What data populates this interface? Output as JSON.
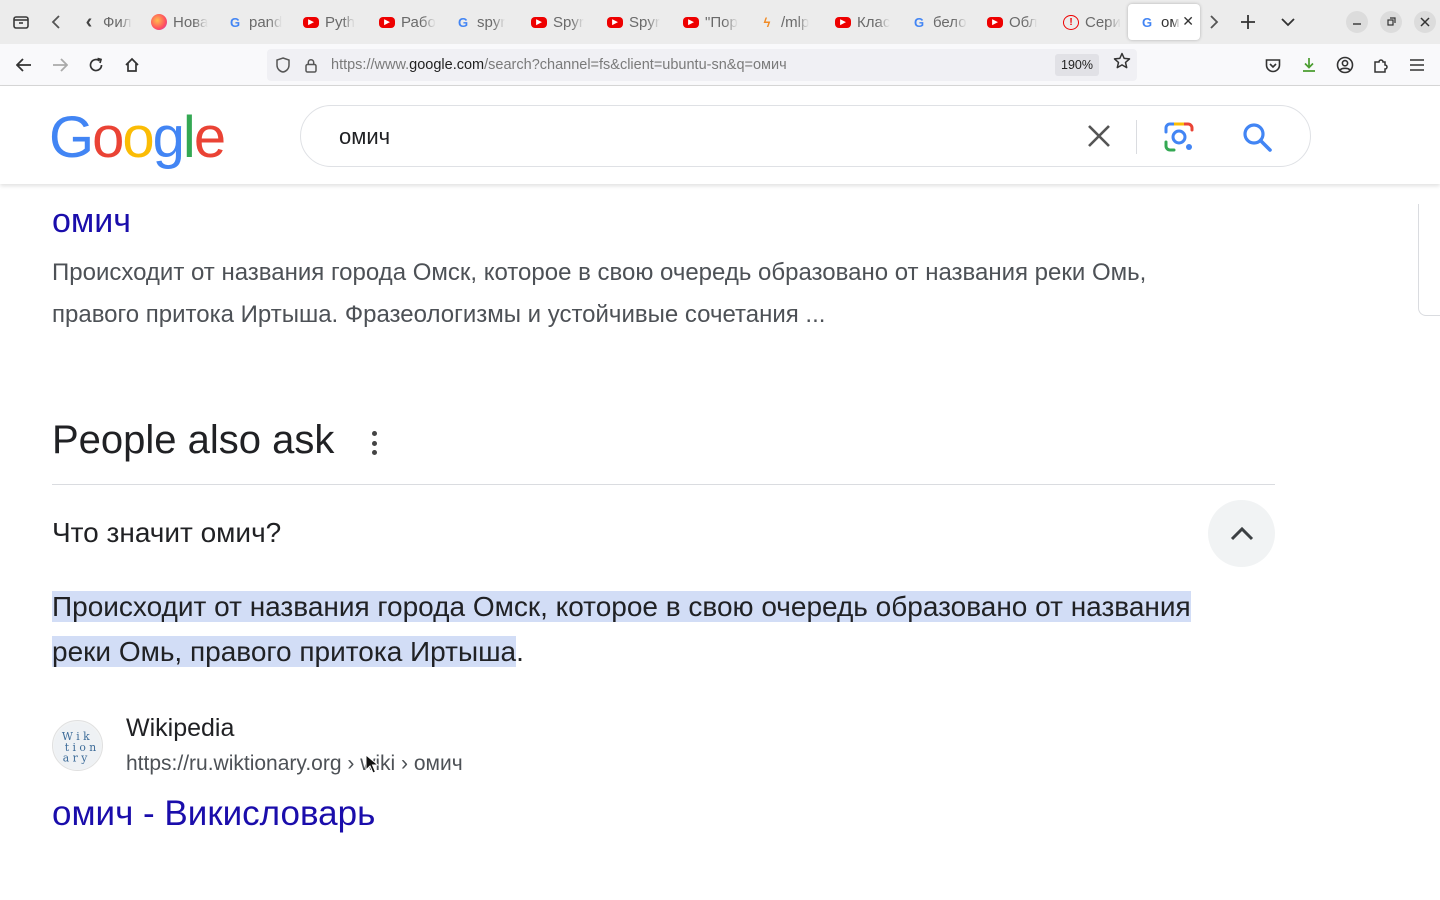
{
  "browser": {
    "tabs": [
      {
        "label": "Фил",
        "icon": "chevron-left-icon",
        "type": "folder"
      },
      {
        "label": "Нова",
        "icon": "firefox-icon",
        "type": "ff"
      },
      {
        "label": "pand",
        "icon": "google-icon",
        "type": "g"
      },
      {
        "label": "Pyth",
        "icon": "youtube-icon",
        "type": "yt"
      },
      {
        "label": "Рабо",
        "icon": "youtube-icon",
        "type": "yt"
      },
      {
        "label": "spyr",
        "icon": "google-icon",
        "type": "g"
      },
      {
        "label": "Spyr",
        "icon": "youtube-icon",
        "type": "yt"
      },
      {
        "label": "Spyr",
        "icon": "youtube-icon",
        "type": "yt"
      },
      {
        "label": "\"Пор",
        "icon": "youtube-icon",
        "type": "yt"
      },
      {
        "label": "/mlp",
        "icon": "bolt-icon",
        "type": "bolt"
      },
      {
        "label": "Клас",
        "icon": "youtube-icon",
        "type": "yt"
      },
      {
        "label": "бело",
        "icon": "google-icon",
        "type": "g"
      },
      {
        "label": "Обл",
        "icon": "youtube-icon",
        "type": "yt"
      },
      {
        "label": "Сери",
        "icon": "warning-icon",
        "type": "warn"
      }
    ],
    "active_tab": {
      "label": "ом",
      "icon": "google-icon"
    },
    "url_prefix": "https://www.",
    "url_domain": "google.com",
    "url_rest": "/search?channel=fs&client=ubuntu-sn&q=омич",
    "zoom": "190%"
  },
  "google": {
    "logo": [
      "G",
      "o",
      "o",
      "g",
      "l",
      "e"
    ],
    "logo_colors": [
      "#4285F4",
      "#EA4335",
      "#FBBC05",
      "#4285F4",
      "#34A853",
      "#EA4335"
    ],
    "query": "омич"
  },
  "result": {
    "title": "омич",
    "snippet": "Происходит от названия города Омск, которое в свою очередь образовано от названия реки Омь, правого притока Иртыша. Фразеологизмы и устойчивые сочетания ..."
  },
  "paa": {
    "heading": "People also ask",
    "question": "Что значит омич?",
    "answer_highlighted": "Происходит от названия города Омск, которое в свою очередь образовано от названия реки Омь, правого притока Иртыша",
    "answer_tail": ".",
    "source_name": "Wikipedia",
    "source_url": "https://ru.wiktionary.org › wiki › омич",
    "source_title": "омич - Викисловарь",
    "favicon_text": "Wik\ntion\nary"
  }
}
